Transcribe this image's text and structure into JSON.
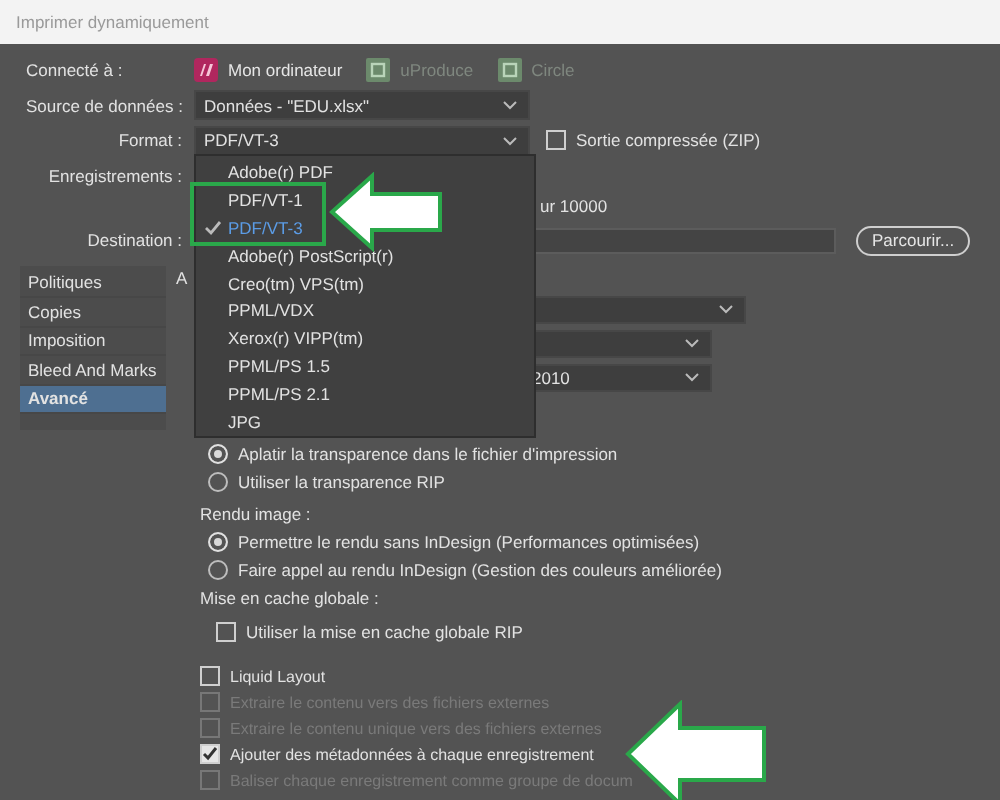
{
  "window": {
    "title": "Imprimer dynamiquement"
  },
  "connection": {
    "label": "Connecté à :",
    "targets": [
      {
        "name": "Mon ordinateur",
        "selected": true
      },
      {
        "name": "uProduce",
        "selected": false
      },
      {
        "name": "Circle",
        "selected": false
      }
    ]
  },
  "data_source": {
    "label": "Source de données :",
    "value": "Données - \"EDU.xlsx\""
  },
  "format": {
    "label": "Format :",
    "value": "PDF/VT-3",
    "zip": {
      "label": "Sortie compressée (ZIP)",
      "checked": false
    }
  },
  "records": {
    "label": "Enregistrements :",
    "text": "ur 10000"
  },
  "destination": {
    "label": "Destination :",
    "button": "Parcourir..."
  },
  "sidebar": {
    "items": [
      {
        "label": "Politiques",
        "selected": false
      },
      {
        "label": "Copies",
        "selected": false
      },
      {
        "label": "Imposition",
        "selected": false
      },
      {
        "label": "Bleed And Marks",
        "selected": false
      },
      {
        "label": "Avancé",
        "selected": true
      }
    ]
  },
  "section_heading": "A",
  "dropdowns": [
    {
      "kind": "empty"
    },
    {
      "kind": "empty"
    },
    {
      "kind": "value",
      "value": "2010"
    }
  ],
  "transparency": {
    "options": [
      {
        "label": "Aplatir la transparence dans le fichier d'impression",
        "selected": true
      },
      {
        "label": "Utiliser la transparence RIP",
        "selected": false
      }
    ]
  },
  "image_rendering": {
    "label": "Rendu image :",
    "options": [
      {
        "label": "Permettre le rendu sans InDesign (Performances optimisées)",
        "selected": true
      },
      {
        "label": "Faire appel au rendu InDesign (Gestion des couleurs améliorée)",
        "selected": false
      }
    ]
  },
  "global_cache": {
    "label": "Mise en cache globale :",
    "checkbox": {
      "label": "Utiliser la mise en cache globale RIP",
      "checked": false
    }
  },
  "options": [
    {
      "label": "Liquid Layout",
      "checked": false,
      "disabled": false
    },
    {
      "label": "Extraire le contenu vers des fichiers externes",
      "checked": false,
      "disabled": true
    },
    {
      "label": "Extraire le contenu unique vers des fichiers externes",
      "checked": false,
      "disabled": true
    },
    {
      "label": "Ajouter des métadonnées à chaque enregistrement",
      "checked": true,
      "disabled": false
    },
    {
      "label": "Baliser chaque enregistrement comme groupe de docum",
      "checked": false,
      "disabled": true
    }
  ],
  "format_menu": {
    "items": [
      {
        "label": "Adobe(r) PDF",
        "selected": false
      },
      {
        "label": "PDF/VT-1",
        "selected": false
      },
      {
        "label": "PDF/VT-3",
        "selected": true
      },
      {
        "label": "Adobe(r) PostScript(r)",
        "selected": false
      },
      {
        "label": "Creo(tm) VPS(tm)",
        "selected": false
      },
      {
        "label": "PPML/VDX",
        "selected": false
      },
      {
        "label": "Xerox(r) VIPP(tm)",
        "selected": false
      },
      {
        "label": "PPML/PS 1.5",
        "selected": false
      },
      {
        "label": "PPML/PS 2.1",
        "selected": false
      },
      {
        "label": "JPG",
        "selected": false
      }
    ]
  }
}
